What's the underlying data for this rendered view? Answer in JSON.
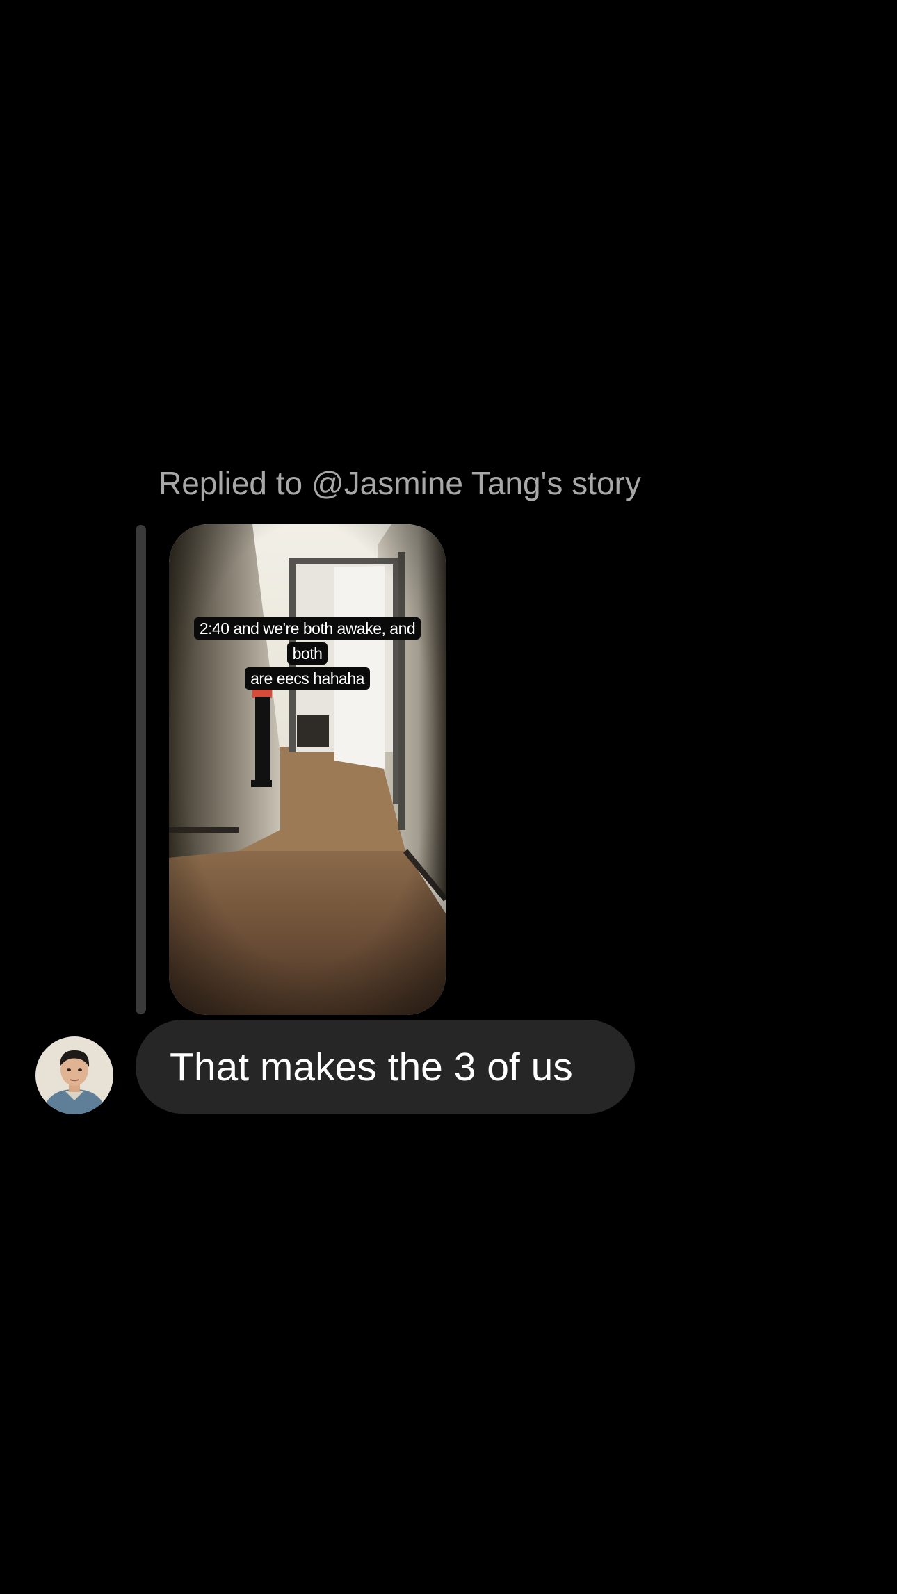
{
  "reply_context": {
    "header": "Replied to @Jasmine Tang's story",
    "story": {
      "caption_line1": "2:40 and we're both awake, and both",
      "caption_line2": "are eecs hahaha"
    }
  },
  "message": {
    "text": "That makes the 3 of us"
  },
  "sender": {
    "avatar": "profile-photo"
  },
  "colors": {
    "background": "#000000",
    "bubble": "#262626",
    "secondary_text": "#a8a8a8",
    "reply_bar": "#3a3a3a"
  }
}
